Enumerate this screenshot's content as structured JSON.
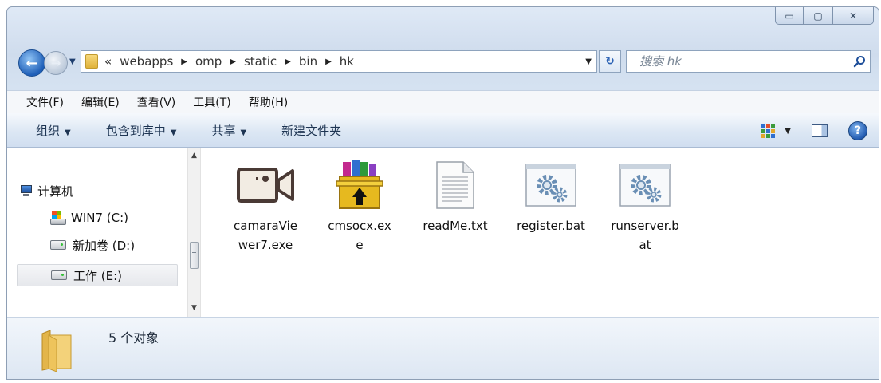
{
  "window": {
    "minimize_glyph": "▭",
    "maximize_glyph": "▢",
    "close_glyph": "✕"
  },
  "nav": {
    "back_glyph": "←",
    "forward_glyph": "→",
    "breadcrumb_overflow": "«",
    "breadcrumbs": [
      "webapps",
      "omp",
      "static",
      "bin",
      "hk"
    ],
    "refresh_glyph": "↻",
    "search_placeholder": "搜索 hk"
  },
  "menu": {
    "items": [
      "文件(F)",
      "编辑(E)",
      "查看(V)",
      "工具(T)",
      "帮助(H)"
    ]
  },
  "toolbar": {
    "organize": "组织",
    "include_in_library": "包含到库中",
    "share": "共享",
    "new_folder": "新建文件夹",
    "help_glyph": "?"
  },
  "sidebar": {
    "computer": "计算机",
    "drives": [
      {
        "label": "WIN7 (C:)",
        "icon": "windows-drive-icon"
      },
      {
        "label": "新加卷 (D:)",
        "icon": "drive-icon"
      },
      {
        "label": "工作 (E:)",
        "icon": "drive-icon"
      }
    ]
  },
  "files": [
    {
      "name": "camaraViewer7.exe",
      "icon": "camera-icon"
    },
    {
      "name": "cmsocx.exe",
      "icon": "winrar-icon"
    },
    {
      "name": "readMe.txt",
      "icon": "text-file-icon"
    },
    {
      "name": "register.bat",
      "icon": "batch-file-icon"
    },
    {
      "name": "runserver.bat",
      "icon": "batch-file-icon"
    }
  ],
  "status": {
    "count_text": "5 个对象"
  },
  "colors": {
    "chrome": "#cfdced",
    "address_border": "#8ea3bd",
    "back_button": "#1f5fb8"
  }
}
